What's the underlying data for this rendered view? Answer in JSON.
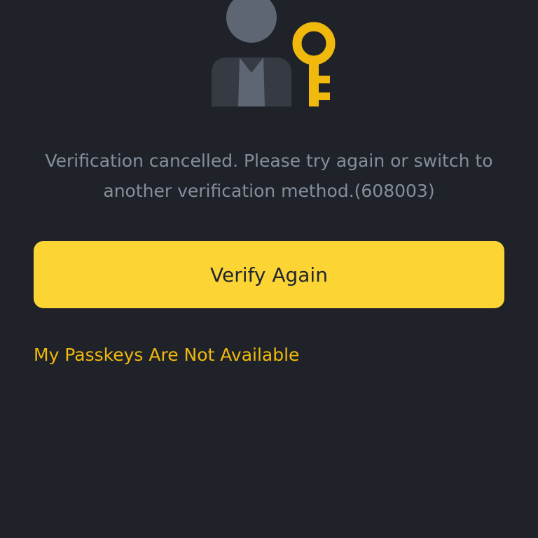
{
  "illustration": {
    "icon": "passkey-user-key-icon",
    "colors": {
      "head": "#5e6673",
      "body": "#363a42",
      "tie": "#5e6673",
      "key": "#f0b90b"
    }
  },
  "message": {
    "line1": "Verification cancelled. Please try again or switch to",
    "line2": "another verification method.(608003)"
  },
  "actions": {
    "verify_again_label": "Verify Again",
    "passkeys_unavailable_label": "My Passkeys Are Not Available"
  },
  "theme": {
    "background": "#1f2329",
    "accent": "#fcd535",
    "link": "#f0b90b",
    "text_secondary": "#848e9c"
  }
}
